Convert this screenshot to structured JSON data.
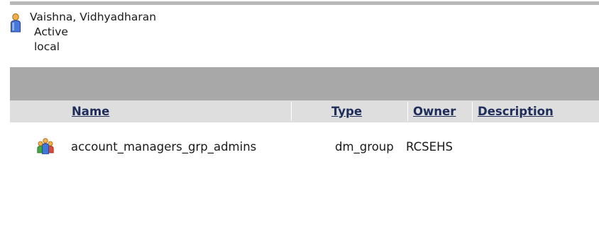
{
  "user": {
    "name": "Vaishna, Vidhyadharan",
    "status": "Active",
    "domain": "local",
    "icon": "user-icon"
  },
  "table": {
    "columns": {
      "name": "Name",
      "type": "Type",
      "owner": "Owner",
      "description": "Description"
    },
    "rows": [
      {
        "icon": "group-icon",
        "name": "account_managers_grp_admins",
        "type": "dm_group",
        "owner": "RCSEHS",
        "description": ""
      }
    ]
  },
  "colors": {
    "header_link": "#1f2d5a",
    "gray_band": "#a8a8a8",
    "header_row": "#dedede"
  }
}
